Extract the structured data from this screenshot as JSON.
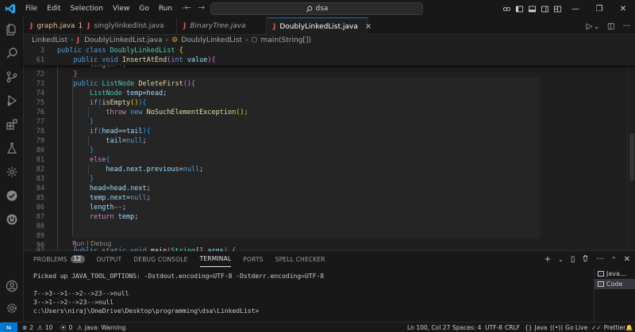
{
  "titlebar": {
    "menu": [
      "File",
      "Edit",
      "Selection",
      "View",
      "Go",
      "Run",
      "···"
    ],
    "search_text": "dsa",
    "window_controls": [
      "—",
      "❐",
      "✕"
    ]
  },
  "tabs": [
    {
      "label": "graph.java",
      "badge": "1",
      "warning": true,
      "active": false
    },
    {
      "label": "singlylinkedlist.java",
      "active": false
    },
    {
      "label": "BinaryTree.java",
      "active": false,
      "italic": true
    },
    {
      "label": "DoublyLinkedList.java",
      "active": true
    }
  ],
  "breadcrumb": {
    "items": [
      "LinkedList",
      "DoublyLinkedList.java",
      "DoublyLinkedList",
      "main(String[])"
    ],
    "separators": [
      "›",
      "›",
      "›"
    ]
  },
  "sticky": [
    {
      "num": "3",
      "text": "public class DoublyLinkedList {"
    },
    {
      "num": "61",
      "text": "    public void InsertAtEnd(int value){"
    }
  ],
  "editor": {
    "partial_line": "        length++;",
    "lines": [
      {
        "num": "72",
        "text": "    }"
      },
      {
        "num": "73",
        "text": "    public ListNode DeleteFirst(){"
      },
      {
        "num": "74",
        "text": "        ListNode temp=head;"
      },
      {
        "num": "75",
        "text": "        if(isEmpty()){"
      },
      {
        "num": "76",
        "text": "            throw new NoSuchElementException();"
      },
      {
        "num": "77",
        "text": "        }"
      },
      {
        "num": "78",
        "text": "        if(head==tail){"
      },
      {
        "num": "79",
        "text": "            tail=null;"
      },
      {
        "num": "80",
        "text": "        }"
      },
      {
        "num": "81",
        "text": "        else{"
      },
      {
        "num": "82",
        "text": "            head.next.previous=null;"
      },
      {
        "num": "83",
        "text": "        }"
      },
      {
        "num": "84",
        "text": "        head=head.next;"
      },
      {
        "num": "85",
        "text": "        temp.next=null;"
      },
      {
        "num": "86",
        "text": "        length--;"
      },
      {
        "num": "87",
        "text": "        return temp;"
      },
      {
        "num": "88",
        "text": ""
      },
      {
        "num": "89",
        "text": ""
      },
      {
        "num": "90",
        "text": "    }"
      }
    ],
    "codelens": "Run | Debug",
    "last_line": {
      "num": "92",
      "text": "    public static void main(String[] args) {"
    }
  },
  "panel": {
    "tabs": [
      "PROBLEMS",
      "OUTPUT",
      "DEBUG CONSOLE",
      "TERMINAL",
      "PORTS",
      "SPELL CHECKER"
    ],
    "problems_count": "12",
    "active_tab": "TERMINAL",
    "actions": [
      "+",
      "⌄",
      "▯",
      "🗑",
      "···",
      "⌃",
      "✕"
    ],
    "terminal_lines": [
      "Picked up JAVA_TOOL_OPTIONS: -Dstdout.encoding=UTF-8 -Dstderr.encoding=UTF-8",
      "",
      "7-->3-->1-->2-->23-->null",
      "3-->1-->2-->23-->null",
      "c:\\Users\\niraj\\OneDrive\\Desktop\\programming\\dsa\\LinkedList>"
    ],
    "terminal_list": [
      "Java...",
      "Code"
    ]
  },
  "statusbar": {
    "remote": "⇋",
    "errors": "2",
    "warnings": "10",
    "ports": "0",
    "java_status": "Java: Warning",
    "cursor": "Ln 100, Col 27",
    "spaces": "Spaces: 4",
    "encoding": "UTF-8",
    "eol": "CRLF",
    "language": "Java",
    "golive": "Go Live",
    "prettier": "Prettier"
  },
  "colors": {
    "accent": "#0078d4",
    "keyword": "#569cd6",
    "type": "#4ec9b0",
    "function": "#dcdcaa",
    "variable": "#9cdcfe",
    "java_icon": "#e35454"
  }
}
